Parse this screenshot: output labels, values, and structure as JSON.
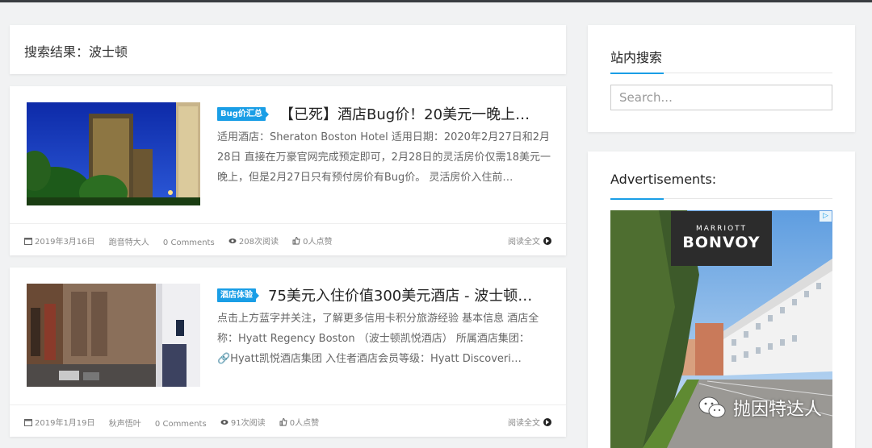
{
  "search_result": {
    "title": "搜索结果：波士顿"
  },
  "posts": [
    {
      "category": "Bug价汇总",
      "title": "【已死】酒店Bug价！20美元一晚上…",
      "excerpt": "适用酒店：Sheraton Boston Hotel 适用日期：2020年2月27日和2月28日 直接在万豪官网完成预定即可，2月28日的灵活房价仅需18美元一晚上，但是2月27日只有预付房价有Bug价。 灵活房价入住前…",
      "date": "2019年3月16日",
      "author": "跑音特大人",
      "comments": "0 Comments",
      "views": "208次阅读",
      "likes": "0人点赞",
      "read_more": "阅读全文"
    },
    {
      "category": "酒店体验",
      "title": "75美元入住价值300美元酒店 - 波士顿…",
      "excerpt": "点击上方蓝字并关注，了解更多信用卡积分旅游经验 基本信息 酒店全称：Hyatt Regency Boston （波士顿凯悦酒店） 所属酒店集团：🔗Hyatt凯悦酒店集团 入住者酒店会员等级：Hyatt Discoveri…",
      "date": "2019年1月19日",
      "author": "秋声悟叶",
      "comments": "0 Comments",
      "views": "91次阅读",
      "likes": "0人点赞",
      "read_more": "阅读全文"
    }
  ],
  "sidebar": {
    "search_widget_title": "站内搜索",
    "search_placeholder": "Search...",
    "ads_widget_title": "Advertisements:",
    "ad": {
      "brand_top": "MARRIOTT",
      "brand_main": "BONVOY",
      "adchoices": "▷"
    }
  },
  "watermark": "抛因特达人",
  "colors": {
    "accent": "#1a9ee6",
    "background": "#f1f2f3"
  }
}
